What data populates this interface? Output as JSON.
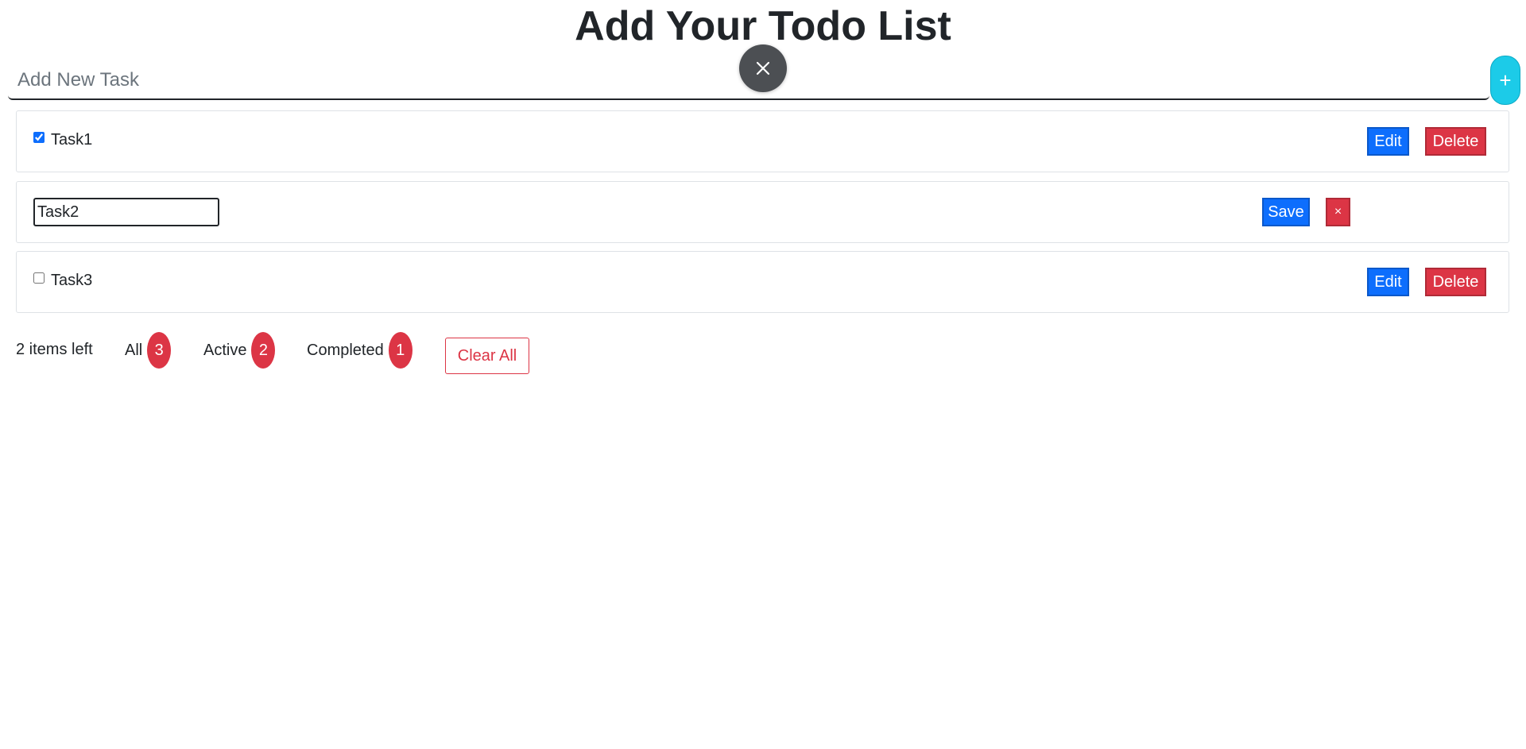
{
  "header": {
    "title": "Add Your Todo List"
  },
  "new_task": {
    "placeholder": "Add New Task",
    "value": "",
    "add_label": "+",
    "close_icon": "close-icon"
  },
  "tasks": [
    {
      "label": "Task1",
      "checked": true,
      "mode": "view",
      "edit_label": "Edit",
      "delete_label": "Delete"
    },
    {
      "value": "Task2",
      "mode": "editing",
      "save_label": "Save",
      "cancel_label": "×"
    },
    {
      "label": "Task3",
      "checked": false,
      "mode": "view",
      "edit_label": "Edit",
      "delete_label": "Delete"
    }
  ],
  "footer": {
    "items_left": "2 items left",
    "filters": [
      {
        "label": "All",
        "count": "3"
      },
      {
        "label": "Active",
        "count": "2"
      },
      {
        "label": "Completed",
        "count": "1"
      }
    ],
    "clear_all_label": "Clear All"
  },
  "colors": {
    "primary": "#0d6efd",
    "danger": "#dc3545",
    "info": "#1ccbe8",
    "close_bg": "#4c4f53",
    "text": "#212529"
  }
}
